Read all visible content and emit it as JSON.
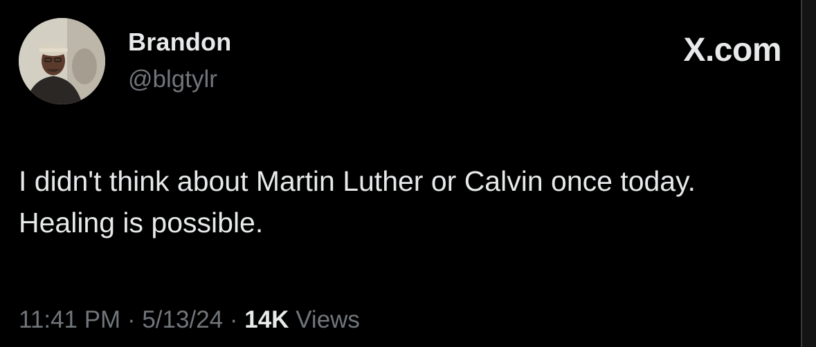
{
  "tweet": {
    "author_name": "Brandon",
    "author_handle": "@blgtylr",
    "brand": "X.com",
    "text": "I didn't think about Martin Luther or Calvin once today. Healing is possible.",
    "time": "11:41 PM",
    "separator": "·",
    "date": "5/13/24",
    "views_count": "14K",
    "views_label": "Views"
  },
  "colors": {
    "background": "#000000",
    "primary_text": "#e7e9ea",
    "secondary_text": "#71767b"
  },
  "icons": {
    "avatar": "profile-photo"
  }
}
